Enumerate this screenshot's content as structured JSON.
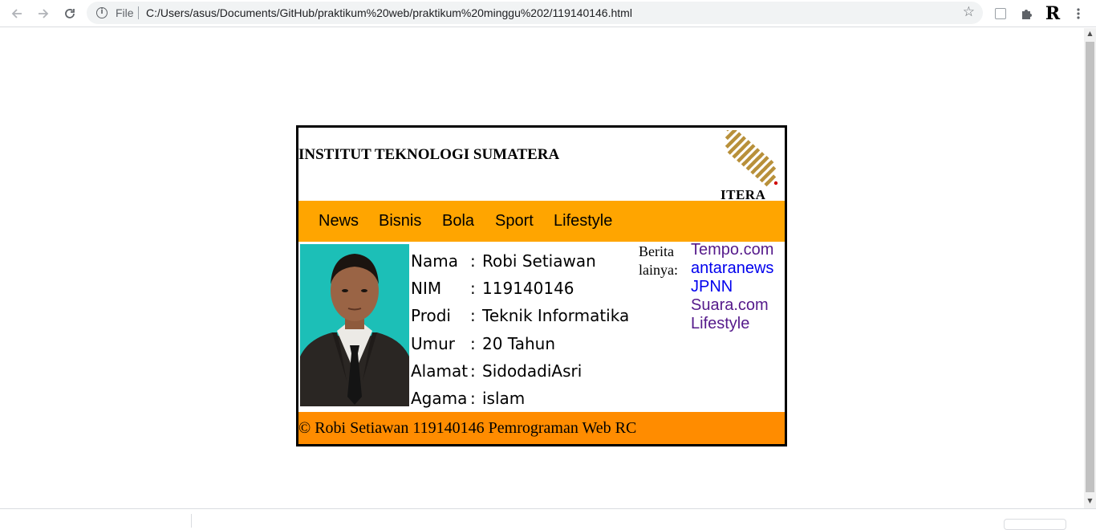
{
  "browser": {
    "scheme_label": "File",
    "url": "C:/Users/asus/Documents/GitHub/praktikum%20web/praktikum%20minggu%202/119140146.html",
    "icons": {
      "back": "back-arrow-icon",
      "forward": "forward-arrow-icon",
      "reload": "reload-icon",
      "info": "info-icon",
      "star": "star-icon",
      "extension": "extension-icon",
      "puzzle": "puzzle-icon",
      "r_extension": "r-extension-icon",
      "menu": "kebab-menu-icon"
    },
    "r_extension_letter": "R"
  },
  "page": {
    "institution": "INSTITUT TEKNOLOGI SUMATERA",
    "logo_text": "ITERA",
    "nav": [
      "News",
      "Bisnis",
      "Bola",
      "Sport",
      "Lifestyle"
    ],
    "profile": {
      "rows": [
        {
          "label": "Nama",
          "value": "Robi Setiawan"
        },
        {
          "label": "NIM",
          "value": "119140146"
        },
        {
          "label": "Prodi",
          "value": "Teknik Informatika"
        },
        {
          "label": "Umur",
          "value": "20 Tahun"
        },
        {
          "label": "Alamat",
          "value": "SidodadiAsri"
        },
        {
          "label": "Agama",
          "value": "islam"
        }
      ],
      "separator": ":"
    },
    "berita_label_1": "Berita",
    "berita_label_2": "lainya:",
    "links": [
      {
        "text": "Tempo.com",
        "visited": true
      },
      {
        "text": "antaranews",
        "visited": false
      },
      {
        "text": "JPNN",
        "visited": false
      },
      {
        "text": "Suara.com",
        "visited": true
      },
      {
        "text": "Lifestyle",
        "visited": true
      }
    ],
    "footer": "© Robi Setiawan 119140146 Pemrograman Web RC",
    "colors": {
      "nav_bg": "#ffa500",
      "footer_bg": "#ff8c00",
      "photo_bg": "#1cbfb7",
      "visited_link": "#551a8b",
      "link": "#0000ee"
    }
  }
}
